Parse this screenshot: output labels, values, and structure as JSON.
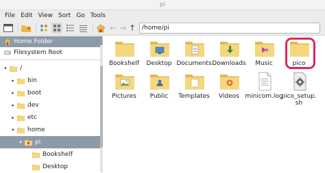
{
  "window": {
    "title": "pi"
  },
  "menu": [
    "File",
    "Edit",
    "View",
    "Sort",
    "Go",
    "Tools"
  ],
  "toolbar": {
    "path": "/home/pi"
  },
  "sidebar": {
    "places": [
      {
        "label": "Home Folder",
        "icon": "home-icon",
        "selected": true
      },
      {
        "label": "Filesystem Root",
        "icon": "drive-icon",
        "selected": false
      }
    ],
    "tree": [
      {
        "label": "/",
        "arrow": "▾",
        "indent": 0,
        "selected": false
      },
      {
        "label": "bin",
        "arrow": "▸",
        "indent": 1,
        "selected": false
      },
      {
        "label": "boot",
        "arrow": "▸",
        "indent": 1,
        "selected": false
      },
      {
        "label": "dev",
        "arrow": "▸",
        "indent": 1,
        "selected": false
      },
      {
        "label": "etc",
        "arrow": "▸",
        "indent": 1,
        "selected": false
      },
      {
        "label": "home",
        "arrow": "▾",
        "indent": 1,
        "selected": false
      },
      {
        "label": "pi",
        "arrow": "▾",
        "indent": 2,
        "selected": true,
        "home": true
      },
      {
        "label": "Bookshelf",
        "arrow": "",
        "indent": 3,
        "selected": false
      },
      {
        "label": "Desktop",
        "arrow": "",
        "indent": 3,
        "selected": false
      }
    ]
  },
  "files": [
    {
      "name": "Bookshelf",
      "type": "folder",
      "emblem": ""
    },
    {
      "name": "Desktop",
      "type": "folder",
      "emblem": "desktop"
    },
    {
      "name": "Documents",
      "type": "folder",
      "emblem": "documents"
    },
    {
      "name": "Downloads",
      "type": "folder",
      "emblem": "downloads"
    },
    {
      "name": "Music",
      "type": "folder",
      "emblem": "music"
    },
    {
      "name": "pico",
      "type": "folder",
      "emblem": "",
      "highlighted": true
    },
    {
      "name": "Pictures",
      "type": "folder",
      "emblem": "pictures"
    },
    {
      "name": "Public",
      "type": "folder",
      "emblem": "public"
    },
    {
      "name": "Templates",
      "type": "folder",
      "emblem": "templates"
    },
    {
      "name": "Videos",
      "type": "folder",
      "emblem": "videos"
    },
    {
      "name": "minicom.log",
      "type": "text-file",
      "emblem": ""
    },
    {
      "name": "pico_setup.sh",
      "type": "script-file",
      "emblem": ""
    }
  ],
  "colors": {
    "folder": "#f5d77d",
    "folder_dark": "#e2b94f",
    "selection": "#8d9aa8",
    "highlight_ring": "#e0245e"
  }
}
